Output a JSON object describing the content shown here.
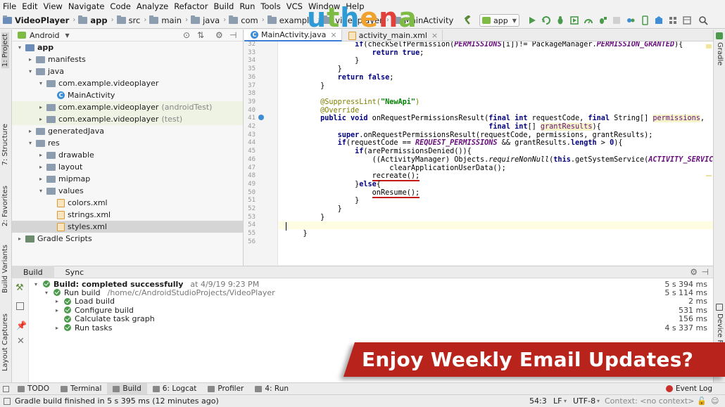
{
  "menu": [
    "File",
    "Edit",
    "View",
    "Navigate",
    "Code",
    "Analyze",
    "Refactor",
    "Build",
    "Run",
    "Tools",
    "VCS",
    "Window",
    "Help"
  ],
  "breadcrumb": [
    "VideoPlayer",
    "app",
    "src",
    "main",
    "java",
    "com",
    "example",
    "videoplayer",
    "MainActivity"
  ],
  "run_config": "app",
  "logo": {
    "letters": [
      "u",
      "t",
      "h",
      "e",
      "n",
      "a"
    ],
    "colors": [
      "#2e9bd6",
      "#7dbb45",
      "#2e9bd6",
      "#f0a22e",
      "#e0413a",
      "#7dbb45"
    ]
  },
  "left_tabs": {
    "project": "1: Project",
    "structure": "7: Structure",
    "favorites": "2: Favorites",
    "build_variants": "Build Variants",
    "layout_captures": "Layout Captures"
  },
  "right_tabs": {
    "gradle": "Gradle",
    "device": "Device Fi"
  },
  "project": {
    "view": "Android",
    "tree": [
      {
        "label": "app",
        "indent": 0,
        "arrow": "▾",
        "icon": "folder-blue",
        "bold": true
      },
      {
        "label": "manifests",
        "indent": 1,
        "arrow": "▸",
        "icon": "folder"
      },
      {
        "label": "java",
        "indent": 1,
        "arrow": "▾",
        "icon": "folder"
      },
      {
        "label": "com.example.videoplayer",
        "indent": 2,
        "arrow": "▾",
        "icon": "folder"
      },
      {
        "label": "MainActivity",
        "indent": 3,
        "arrow": "",
        "icon": "class"
      },
      {
        "label": "com.example.videoplayer",
        "suffix": "(androidTest)",
        "indent": 2,
        "arrow": "▸",
        "icon": "folder",
        "hl": true
      },
      {
        "label": "com.example.videoplayer",
        "suffix": "(test)",
        "indent": 2,
        "arrow": "▸",
        "icon": "folder",
        "hl": true
      },
      {
        "label": "generatedJava",
        "indent": 1,
        "arrow": "▸",
        "icon": "folder"
      },
      {
        "label": "res",
        "indent": 1,
        "arrow": "▾",
        "icon": "folder"
      },
      {
        "label": "drawable",
        "indent": 2,
        "arrow": "▸",
        "icon": "folder"
      },
      {
        "label": "layout",
        "indent": 2,
        "arrow": "▸",
        "icon": "folder"
      },
      {
        "label": "mipmap",
        "indent": 2,
        "arrow": "▸",
        "icon": "folder"
      },
      {
        "label": "values",
        "indent": 2,
        "arrow": "▾",
        "icon": "folder"
      },
      {
        "label": "colors.xml",
        "indent": 3,
        "arrow": "",
        "icon": "xml"
      },
      {
        "label": "strings.xml",
        "indent": 3,
        "arrow": "",
        "icon": "xml"
      },
      {
        "label": "styles.xml",
        "indent": 3,
        "arrow": "",
        "icon": "xml",
        "sel": true
      },
      {
        "label": "Gradle Scripts",
        "indent": 0,
        "arrow": "▸",
        "icon": "gradle"
      }
    ]
  },
  "editor": {
    "tabs": [
      {
        "label": "MainActivity.java",
        "active": true
      },
      {
        "label": "activity_main.xml",
        "active": false
      }
    ],
    "lines": [
      {
        "n": "32",
        "html": "                <span class=\"kw\">if</span>(checkSelfPermission(<span class=\"cst\">PERMISSIONS</span>[i])!= PackageManager.<span class=\"cst\">PERMISSION_GRANTED</span>){"
      },
      {
        "n": "33",
        "html": "                    <span class=\"kw\">return true</span>;"
      },
      {
        "n": "34",
        "html": "                }"
      },
      {
        "n": "35",
        "html": "            }"
      },
      {
        "n": "36",
        "html": "            <span class=\"kw\">return false</span>;"
      },
      {
        "n": "37",
        "html": "        }"
      },
      {
        "n": "38",
        "html": ""
      },
      {
        "n": "39",
        "html": "        <span class=\"ann\">@SuppressLint(</span><span class=\"str\">\"NewApi\"</span><span class=\"ann\">)</span>"
      },
      {
        "n": "40",
        "html": "        <span class=\"ann\">@Override</span>"
      },
      {
        "n": "41",
        "html": "        <span class=\"kw\">public void</span> onRequestPermissionsResult(<span class=\"kw\">final int</span> requestCode, <span class=\"kw\">final</span> String[] <span class=\"par\">permissions</span>,"
      },
      {
        "n": "42",
        "html": "                                               <span class=\"kw\">final int</span>[] <span class=\"par\">grantResults</span>){"
      },
      {
        "n": "43",
        "html": "            <span class=\"kw\">super</span>.onRequestPermissionsResult(requestCode, permissions, grantResults);"
      },
      {
        "n": "44",
        "html": "            <span class=\"kw\">if</span>(requestCode == <span class=\"cst\">REQUEST_PERMISSIONS</span> &amp;&amp; grantResults.<span class=\"kw\">length</span> &gt; <span class=\"kw\">0</span>){"
      },
      {
        "n": "45",
        "html": "                <span class=\"kw\">if</span>(arePermissionsDenied()){"
      },
      {
        "n": "46",
        "html": "                    ((ActivityManager) Objects.<span class=\"mth\">requireNonNull</span>(<span class=\"kw\">this</span>.getSystemService(<span class=\"cst\">ACTIVITY_SERVICE</span>)))."
      },
      {
        "n": "47",
        "html": "                        clearApplicationUserData();"
      },
      {
        "n": "48",
        "html": "                    <span class=\"ul\">recreate();</span>"
      },
      {
        "n": "49",
        "html": "                }<span class=\"kw\">else</span>{"
      },
      {
        "n": "50",
        "html": "                    <span class=\"ul\">onResume();</span>"
      },
      {
        "n": "51",
        "html": "                }"
      },
      {
        "n": "52",
        "html": "            }"
      },
      {
        "n": "53",
        "html": "        }"
      },
      {
        "n": "54",
        "html": ""
      },
      {
        "n": "55",
        "html": "    }"
      },
      {
        "n": "56",
        "html": ""
      }
    ]
  },
  "build": {
    "tabs": [
      "Build",
      "Sync"
    ],
    "rows": [
      {
        "indent": 0,
        "arrow": "▾",
        "text": "Build:",
        "bold": true,
        "rest": "completed successfully",
        "extra": "at 4/9/19 9:23 PM",
        "time": "5 s 394 ms"
      },
      {
        "indent": 1,
        "arrow": "▾",
        "text": "Run build",
        "rest": "",
        "extra": "/home/c/AndroidStudioProjects/VideoPlayer",
        "time": "5 s 114 ms"
      },
      {
        "indent": 2,
        "arrow": "▸",
        "text": "Load build",
        "rest": "",
        "extra": "",
        "time": "2 ms"
      },
      {
        "indent": 2,
        "arrow": "▸",
        "text": "Configure build",
        "rest": "",
        "extra": "",
        "time": "531 ms"
      },
      {
        "indent": 2,
        "arrow": "",
        "text": "Calculate task graph",
        "rest": "",
        "extra": "",
        "time": "156 ms"
      },
      {
        "indent": 2,
        "arrow": "▸",
        "text": "Run tasks",
        "rest": "",
        "extra": "",
        "time": "4 s 337 ms"
      }
    ]
  },
  "banner": "Enjoy Weekly Email Updates?",
  "tool_tabs": [
    {
      "label": "TODO",
      "active": false
    },
    {
      "label": "Terminal",
      "active": false
    },
    {
      "label": "Build",
      "active": true
    },
    {
      "label": "6: Logcat",
      "active": false
    },
    {
      "label": "Profiler",
      "active": false
    },
    {
      "label": "4: Run",
      "active": false
    }
  ],
  "event_log": "Event Log",
  "status": {
    "message": "Gradle build finished in 5 s 395 ms (12 minutes ago)",
    "position": "54:3",
    "line_sep": "LF",
    "encoding": "UTF-8",
    "context": "Context: <no context>"
  }
}
